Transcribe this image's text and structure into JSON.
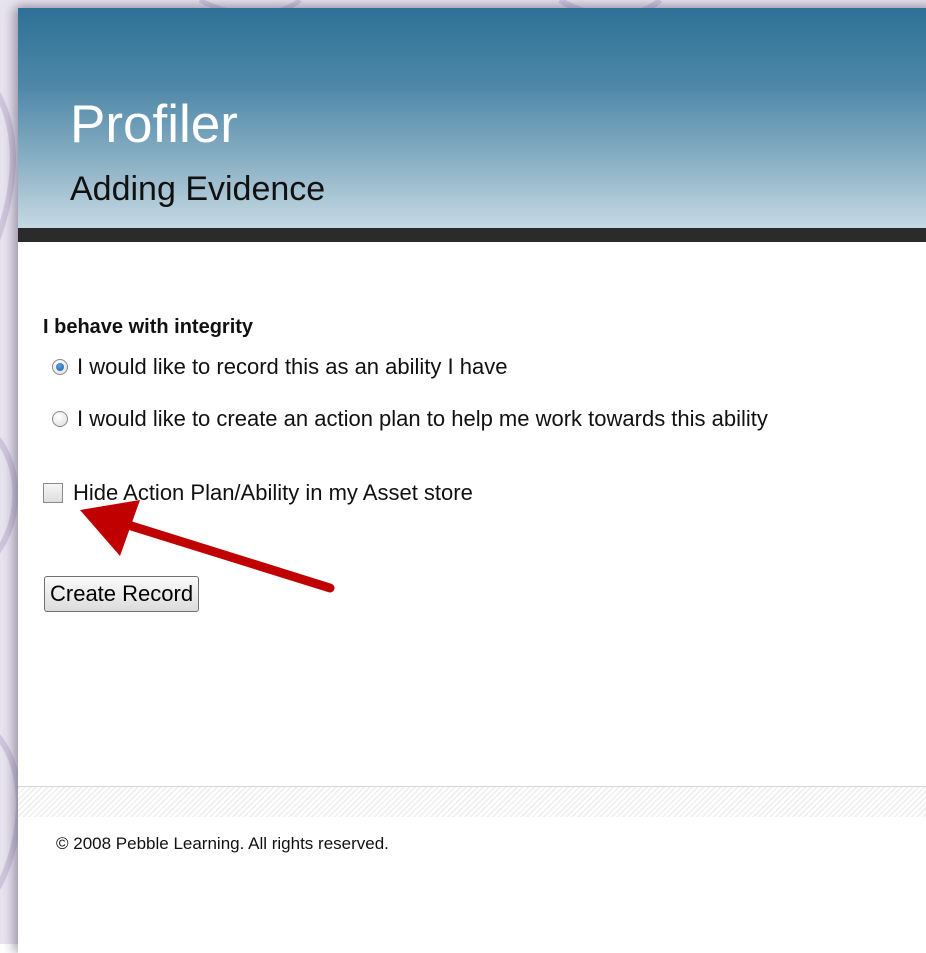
{
  "header": {
    "title": "Profiler",
    "subtitle": "Adding Evidence"
  },
  "form": {
    "question": "I behave with integrity",
    "options": [
      {
        "label": "I would like to record this as an ability I have",
        "selected": true
      },
      {
        "label": "I would like to create an action plan to help me work towards this ability",
        "selected": false
      }
    ],
    "hide_checkbox": {
      "label": "Hide Action Plan/Ability in my Asset store",
      "checked": false
    },
    "submit_label": "Create Record"
  },
  "footer": {
    "copyright": "© 2008 Pebble Learning. All rights reserved."
  },
  "colors": {
    "header_top": "#2e7196",
    "header_bottom": "#c6d9e3",
    "header_bar": "#2b2b2b",
    "annotation_arrow": "#c00000"
  },
  "icons": {
    "annotation": "red-arrow-icon"
  }
}
